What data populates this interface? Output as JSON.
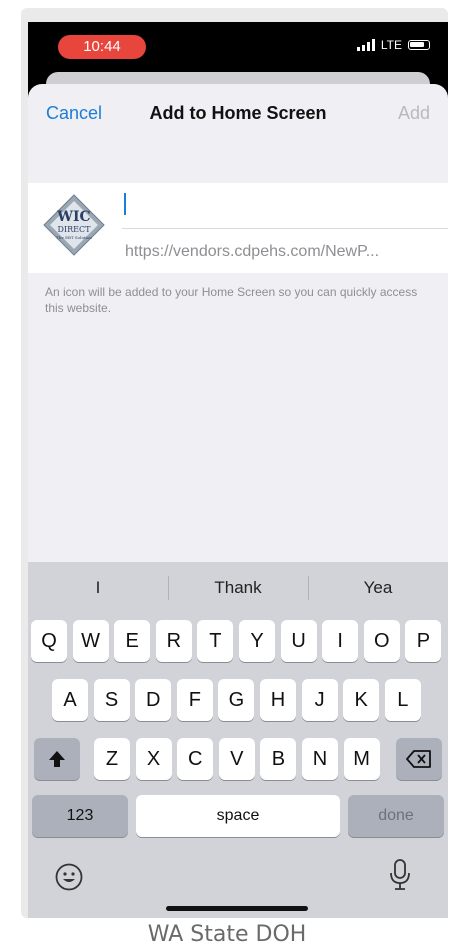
{
  "status": {
    "time": "10:44",
    "network": "LTE"
  },
  "nav": {
    "cancel": "Cancel",
    "title": "Add to Home Screen",
    "add": "Add"
  },
  "card": {
    "title_value": "",
    "url": "https://vendors.cdpehs.com/NewP...",
    "icon_text_top": "WIC",
    "icon_text_mid": "DIRECT",
    "icon_text_bottom": "The EBT Solution"
  },
  "note": "An icon will be added to your Home Screen so you can quickly access this website.",
  "keyboard": {
    "suggestions": [
      "I",
      "Thank",
      "Yea"
    ],
    "row1": [
      "Q",
      "W",
      "E",
      "R",
      "T",
      "Y",
      "U",
      "I",
      "O",
      "P"
    ],
    "row2": [
      "A",
      "S",
      "D",
      "F",
      "G",
      "H",
      "J",
      "K",
      "L"
    ],
    "row3": [
      "Z",
      "X",
      "C",
      "V",
      "B",
      "N",
      "M"
    ],
    "numbers_label": "123",
    "space_label": "space",
    "done_label": "done"
  },
  "colors": {
    "accent": "#1c7ed6",
    "time_pill": "#e8463d",
    "keyboard_bg": "#d1d3d9"
  },
  "icons": {
    "shift": "shift-icon",
    "backspace": "backspace-icon",
    "emoji": "emoji-icon",
    "mic": "microphone-icon"
  },
  "caption": "WA State DOH"
}
